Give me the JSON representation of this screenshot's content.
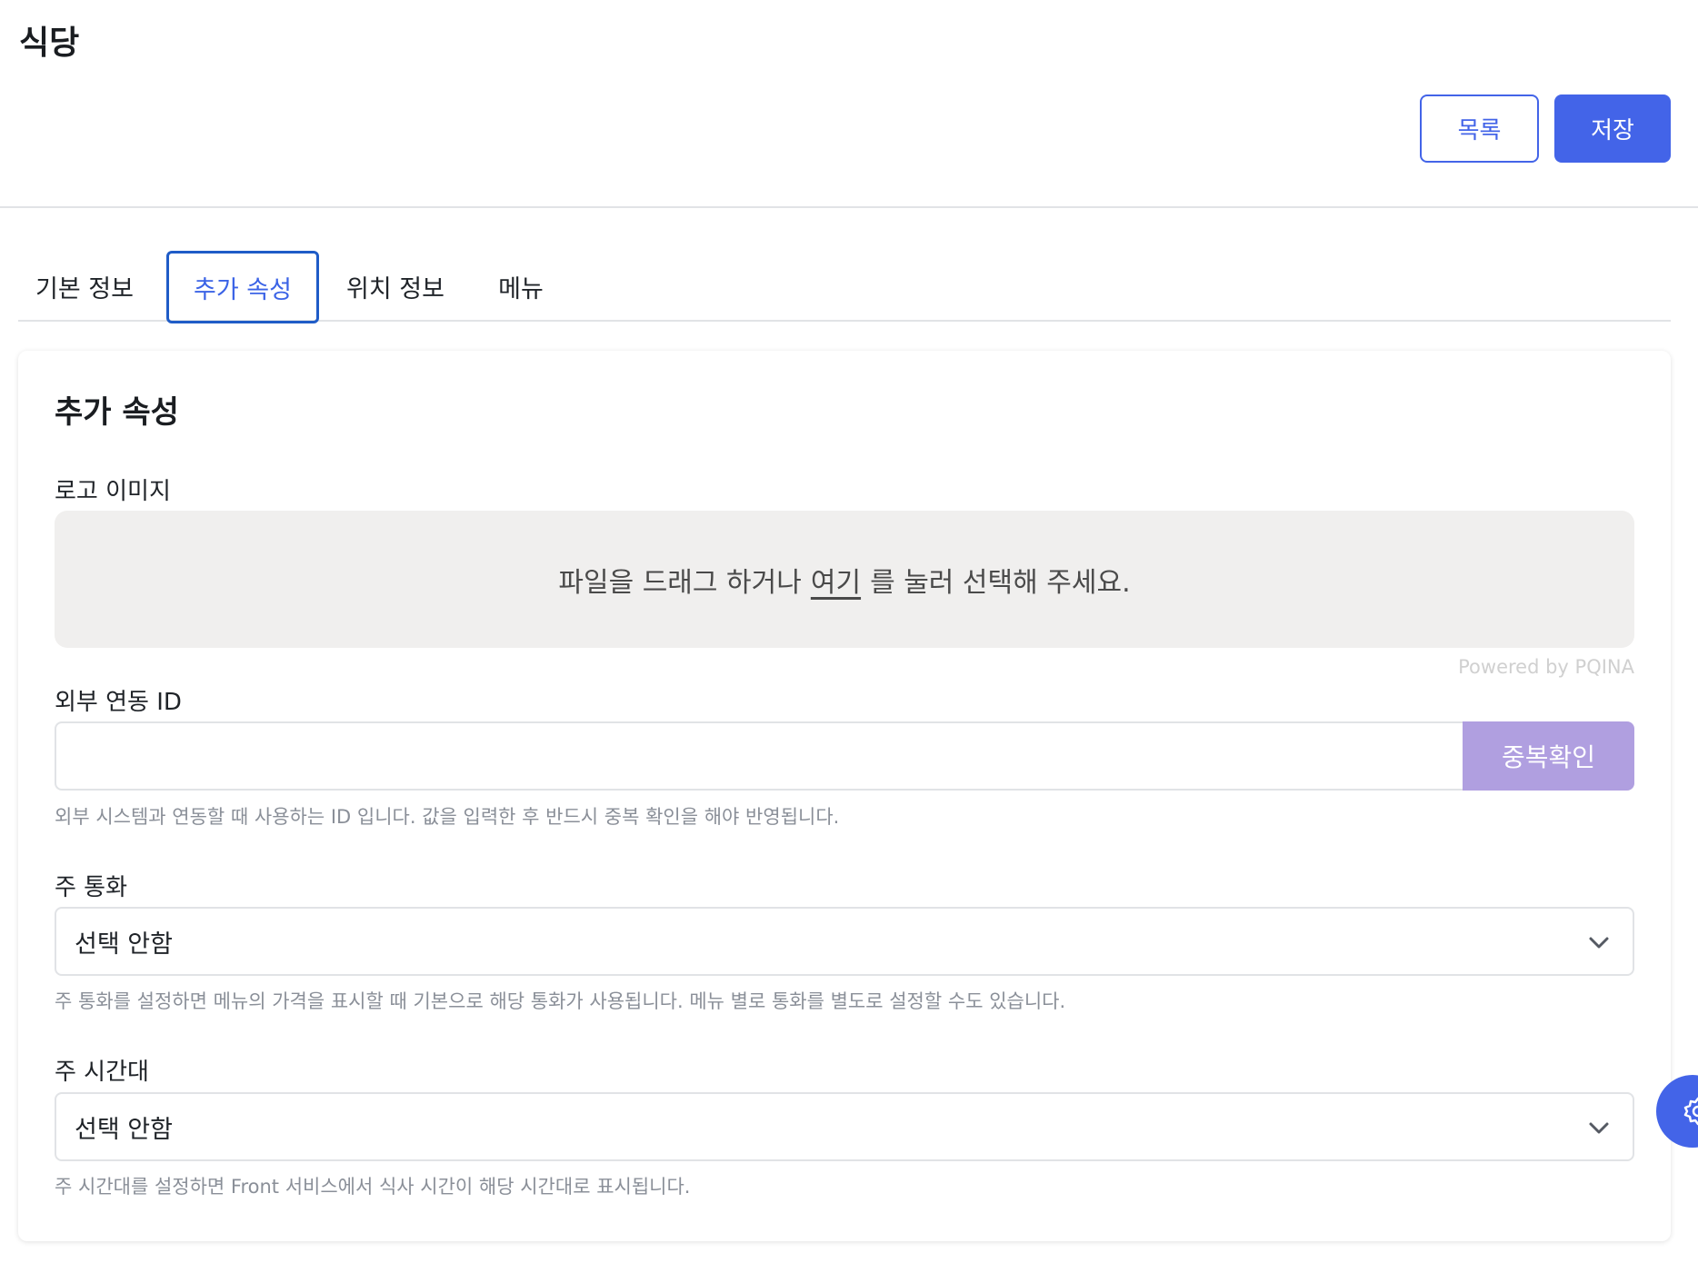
{
  "header": {
    "title": "식당",
    "list_label": "목록",
    "save_label": "저장"
  },
  "tabs": [
    {
      "label": "기본 정보",
      "active": false
    },
    {
      "label": "추가 속성",
      "active": true
    },
    {
      "label": "위치 정보",
      "active": false
    },
    {
      "label": "메뉴",
      "active": false
    }
  ],
  "card": {
    "title": "추가 속성",
    "logo": {
      "label": "로고 이미지",
      "drop_prefix": "파일을 드래그 하거나",
      "drop_link": "여기",
      "drop_suffix": "를 눌러 선택해 주세요.",
      "powered_by": "Powered by PQINA"
    },
    "external_id": {
      "label": "외부 연동 ID",
      "value": "",
      "check_label": "중복확인",
      "help": "외부 시스템과 연동할 때 사용하는 ID 입니다. 값을 입력한 후 반드시 중복 확인을 해야 반영됩니다."
    },
    "currency": {
      "label": "주 통화",
      "selected": "선택 안함",
      "help": "주 통화를 설정하면 메뉴의 가격을 표시할 때 기본으로 해당 통화가 사용됩니다. 메뉴 별로 통화를 별도로 설정할 수도 있습니다."
    },
    "timezone": {
      "label": "주 시간대",
      "selected": "선택 안함",
      "help": "주 시간대를 설정하면 Front 서비스에서 식사 시간이 해당 시간대로 표시됩니다."
    }
  },
  "colors": {
    "primary": "#4364e8",
    "duplicate_check": "#b09fe0",
    "dropzone_bg": "#f0efee"
  },
  "icons": {
    "select_chevron": "chevron-down-icon",
    "fab": "settings-icon"
  }
}
